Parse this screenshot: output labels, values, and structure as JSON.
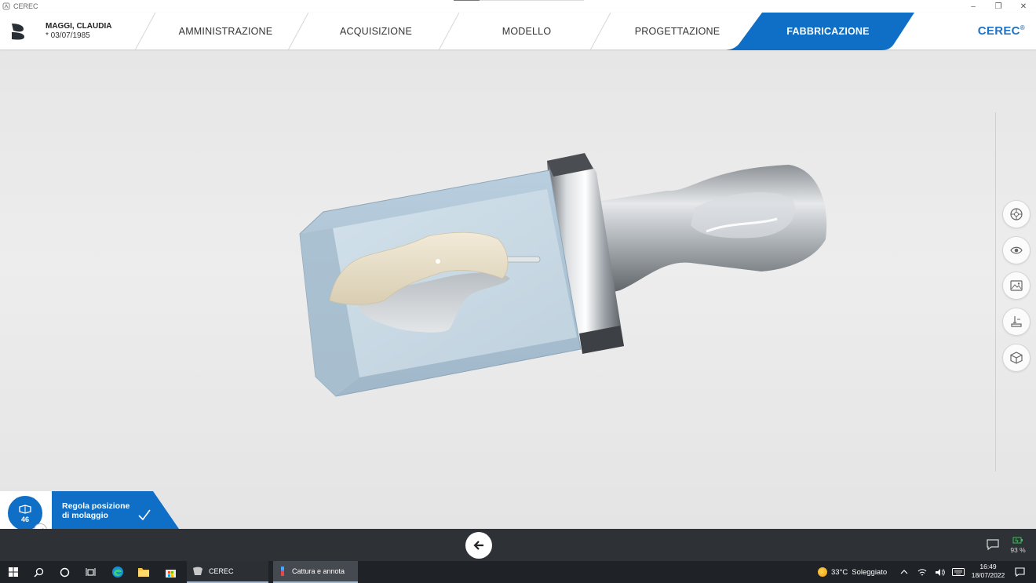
{
  "window": {
    "title": "CEREC",
    "controls": {
      "minimize": "–",
      "restore": "❐",
      "close": "✕"
    }
  },
  "header": {
    "patient_name": "MAGGI, CLAUDIA",
    "patient_dob": "* 03/07/1985",
    "steps": [
      {
        "label": "AMMINISTRAZIONE",
        "active": false
      },
      {
        "label": "ACQUISIZIONE",
        "active": false
      },
      {
        "label": "MODELLO",
        "active": false
      },
      {
        "label": "PROGETTAZIONE",
        "active": false
      },
      {
        "label": "FABBRICAZIONE",
        "active": true
      }
    ],
    "brand": "CEREC",
    "brand_mark": "®",
    "accent_color": "#0f6fc6"
  },
  "side_tools": [
    {
      "icon": "tooth-selector-icon"
    },
    {
      "icon": "eye-icon"
    },
    {
      "icon": "image-view-icon"
    },
    {
      "icon": "sprue-tool-icon"
    },
    {
      "icon": "cube-view-icon"
    }
  ],
  "current_step": {
    "tooth_number": "46",
    "label_line1": "Regola posizione",
    "label_line2": "di molaggio",
    "status": "done"
  },
  "statusbar": {
    "battery_percent": "93 %"
  },
  "taskbar": {
    "apps": [
      {
        "label": "CEREC"
      },
      {
        "label": "Cattura e annota"
      }
    ],
    "weather": {
      "temperature": "33°C",
      "condition": "Soleggiato"
    },
    "time": "16:49",
    "date": "18/07/2022"
  }
}
